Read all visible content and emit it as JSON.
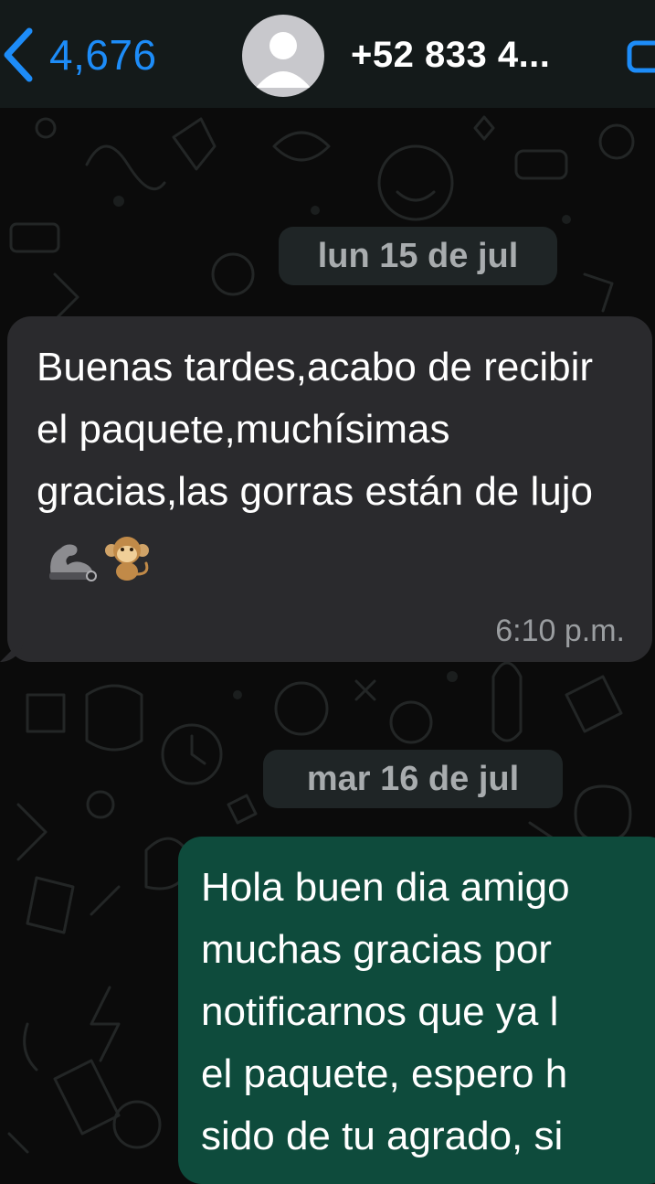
{
  "header": {
    "back_count": "4,676",
    "contact": "+52 833 4..."
  },
  "dates": [
    "lun 15 de jul",
    "mar 16 de jul"
  ],
  "messages": [
    {
      "direction": "incoming",
      "text": "Buenas tardes,acabo de recibir el paquete,muchísimas gracias,las gorras están de lujo",
      "emojis": [
        "flexed-biceps",
        "monkey"
      ],
      "time": "6:10 p.m."
    },
    {
      "direction": "outgoing",
      "lines": [
        "Hola buen dia amigo",
        "muchas gracias por",
        "notificarnos que ya l",
        "el paquete, espero h",
        "sido de tu agrado, si"
      ]
    }
  ],
  "colors": {
    "accent": "#1d8cf8",
    "incoming_bubble": "#2a2a2d",
    "outgoing_bubble": "#0e4b3c",
    "header": "#141a1a"
  }
}
